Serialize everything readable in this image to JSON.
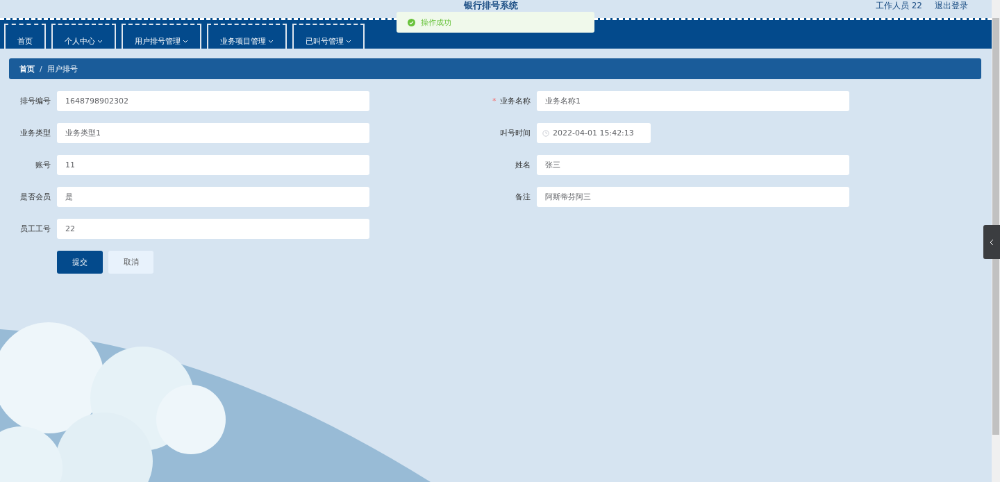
{
  "header": {
    "title": "银行排号系统",
    "user": "工作人员 22",
    "logout": "退出登录"
  },
  "toast": {
    "text": "操作成功"
  },
  "nav": [
    {
      "label": "首页",
      "dropdown": false
    },
    {
      "label": "个人中心",
      "dropdown": true
    },
    {
      "label": "用户排号管理",
      "dropdown": true
    },
    {
      "label": "业务项目管理",
      "dropdown": true
    },
    {
      "label": "已叫号管理",
      "dropdown": true
    }
  ],
  "breadcrumb": {
    "separator": "/",
    "items": [
      {
        "label": "首页",
        "current": false
      },
      {
        "label": "用户排号",
        "current": true
      }
    ]
  },
  "form": {
    "required_mark": "*",
    "left": [
      {
        "label": "排号编号",
        "value": "1648798902302",
        "required": false,
        "kind": "text"
      },
      {
        "label": "业务类型",
        "value": "业务类型1",
        "required": false,
        "kind": "text"
      },
      {
        "label": "账号",
        "value": "11",
        "required": false,
        "kind": "text"
      },
      {
        "label": "是否会员",
        "value": "是",
        "required": false,
        "kind": "text"
      },
      {
        "label": "员工工号",
        "value": "22",
        "required": false,
        "kind": "text"
      }
    ],
    "right": [
      {
        "label": "业务名称",
        "value": "业务名称1",
        "required": true,
        "kind": "text"
      },
      {
        "label": "叫号时间",
        "value": "2022-04-01 15:42:13",
        "required": false,
        "kind": "date"
      },
      {
        "label": "姓名",
        "value": "张三",
        "required": false,
        "kind": "text"
      },
      {
        "label": "备注",
        "value": "阿斯蒂芬阿三",
        "required": false,
        "kind": "text"
      }
    ]
  },
  "buttons": [
    {
      "label": "提交",
      "kind": "primary"
    },
    {
      "label": "取消",
      "kind": "default"
    }
  ]
}
